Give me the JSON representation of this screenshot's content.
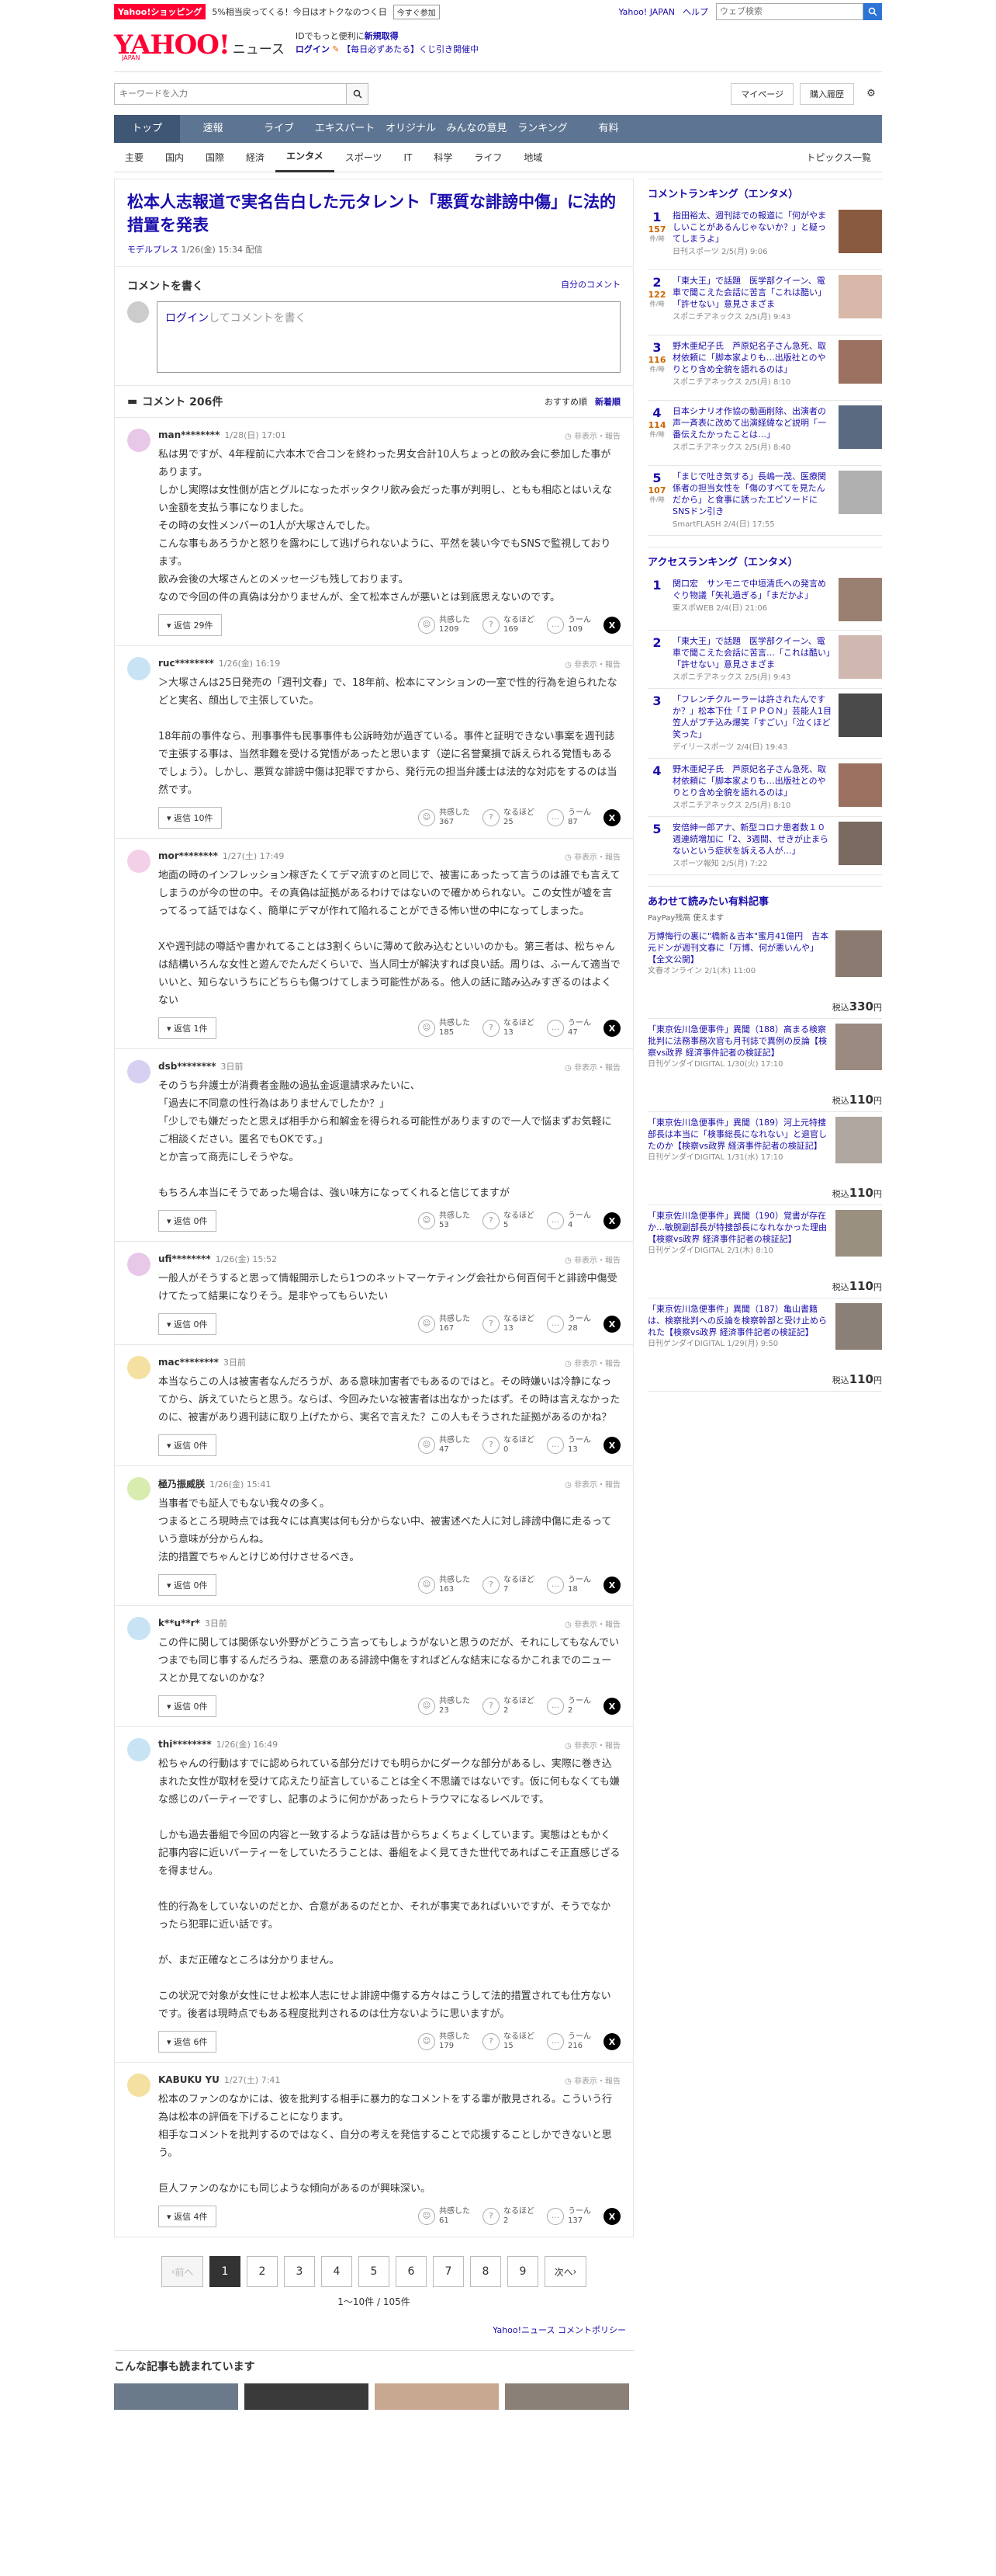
{
  "topbar": {
    "shop_badge": "Yahoo!ショッピング",
    "promo": "5%相当戻ってくる！今日はオトクなのつく日",
    "promo_btn": "今すぐ参加",
    "links": [
      "Yahoo! JAPAN",
      "ヘルプ"
    ],
    "search_placeholder": "ウェブ検索"
  },
  "header": {
    "logo": "YAHOO!",
    "logo_sub": "JAPAN",
    "service": "ニュース",
    "id_line1": "IDでもっと便利に",
    "id_line1_bold": "新規取得",
    "login": "ログイン",
    "lottery": "【毎日必ずあたる】くじ引き開催中"
  },
  "search": {
    "placeholder": "キーワードを入力",
    "mypage": "マイページ",
    "purchase": "購入履歴"
  },
  "nav": [
    "トップ",
    "速報",
    "ライブ",
    "エキスパート",
    "オリジナル",
    "みんなの意見",
    "ランキング",
    "有料"
  ],
  "subnav": [
    "主要",
    "国内",
    "国際",
    "経済",
    "エンタメ",
    "スポーツ",
    "IT",
    "科学",
    "ライフ",
    "地域"
  ],
  "subnav_active": 4,
  "subnav_right": "トピックス一覧",
  "article": {
    "headline": "松本人志報道で実名告白した元タレント「悪質な誹謗中傷」に法的措置を発表",
    "publisher": "モデルプレス",
    "date": "1/26(金) 15:34 配信"
  },
  "comment_write": {
    "title": "コメントを書く",
    "own": "自分のコメント",
    "login": "ログイン",
    "prompt": "してコメントを書く"
  },
  "comments_header": {
    "count": "コメント 206件",
    "sort_recommended": "おすすめ順",
    "sort_new": "新着順"
  },
  "comments": [
    {
      "user": "man********",
      "date": "1/28(日) 17:01",
      "text": "私は男ですが、4年程前に六本木で合コンを終わった男女合計10人ちょっとの飲み会に参加した事があります。\nしかし実際は女性側が店とグルになったボッタクリ飲み会だった事が判明し、ともも相応とはいえない金額を支払う事になりました。\nその時の女性メンバーの1人が大塚さんでした。\nこんな事もあろうかと怒りを露わにして逃げられないように、平然を装い今でもSNSで監視しております。\n飲み会後の大塚さんとのメッセージも残しております。\nなので今回の件の真偽は分かりませんが、全て松本さんが悪いとは到底思えないのです。",
      "replies": "返信 29件",
      "empathy": "1209",
      "naruhodo": "169",
      "uun": "109",
      "avatar": "#e8c8e8"
    },
    {
      "user": "ruc********",
      "date": "1/26(金) 16:19",
      "text": "＞大塚さんは25日発売の「週刊文春」で、18年前、松本にマンションの一室で性的行為を迫られたなどと実名、顔出しで主張していた。\n\n18年前の事件なら、刑事事件も民事事件も公訴時効が過ぎている。事件と証明できない事案を週刊誌で主張する事は、当然非難を受ける覚悟があったと思います（逆に名誉棄損で訴えられる覚悟もあるでしょう）。しかし、悪質な誹謗中傷は犯罪ですから、発行元の担当弁護士は法的な対応をするのは当然です。",
      "replies": "返信 10件",
      "empathy": "367",
      "naruhodo": "25",
      "uun": "87",
      "avatar": "#c8e4f4"
    },
    {
      "user": "mor********",
      "date": "1/27(土) 17:49",
      "text": "地面の時のインフレッション稼ぎたくてデマ流すのと同じで、被害にあったって言うのは誰でも言えてしまうのが今の世の中。その真偽は証拠があるわけではないので確かめられない。この女性が嘘を言ってるって話ではなく、簡単にデマが作れて陥れることができる怖い世の中になってしまった。\n\nXや週刊誌の噂話や書かれてることは3割くらいに薄めて飲み込むといいのかも。第三者は、松ちゃんは結構いろんな女性と遊んでたんだくらいで、当人同士が解決すれば良い話。周りは、ふーんて適当でいいと、知らないうちにどちらも傷つけてしまう可能性がある。他人の話に踏み込みすぎるのはよくない",
      "replies": "返信 1件",
      "empathy": "185",
      "naruhodo": "13",
      "uun": "47",
      "avatar": "#f4d0e8"
    },
    {
      "user": "dsb********",
      "date": "3日前",
      "text": "そのうち弁護士が消費者金融の過払金返還請求みたいに、\n「過去に不同意の性行為はありませんでしたか？」\n「少しでも嫌だったと思えば相手から和解金を得られる可能性がありますので一人で悩まずお気軽にご相談ください。匿名でもOKです。」\nとか言って商売にしそうやな。\n\nもちろん本当にそうであった場合は、強い味方になってくれると信じてますが",
      "replies": "返信 0件",
      "empathy": "53",
      "naruhodo": "5",
      "uun": "4",
      "avatar": "#d8d0f0"
    },
    {
      "user": "ufi********",
      "date": "1/26(金) 15:52",
      "text": "一般人がそうすると思って情報開示したら1つのネットマーケティング会社から何百何千と誹謗中傷受けてたって結果になりそう。是非やってもらいたい",
      "replies": "返信 0件",
      "empathy": "167",
      "naruhodo": "13",
      "uun": "28",
      "avatar": "#e8c8e8"
    },
    {
      "user": "mac********",
      "date": "3日前",
      "text": "本当ならこの人は被害者なんだろうが、ある意味加害者でもあるのではと。その時嫌いは冷静になってから、訴えていたらと思う。ならば、今回みたいな被害者は出なかったはず。その時は言えなかったのに、被害があり週刊誌に取り上げたから、実名で言えた？この人もそうされた証拠があるのかね？",
      "replies": "返信 0件",
      "empathy": "47",
      "naruhodo": "0",
      "uun": "13",
      "avatar": "#f4e0a0"
    },
    {
      "user": "極乃振威朕",
      "date": "1/26(金) 15:41",
      "text": "当事者でも証人でもない我々の多く。\nつまるところ現時点では我々には真実は何も分からない中、被害述べた人に対し誹謗中傷に走るっていう意味が分からんね。\n法的措置でちゃんとけじめ付けさせるべき。",
      "replies": "返信 0件",
      "empathy": "163",
      "naruhodo": "7",
      "uun": "18",
      "avatar": "#d8ecb0"
    },
    {
      "user": "k**u**r*",
      "date": "3日前",
      "text": "この件に関しては関係ない外野がどうこう言ってもしょうがないと思うのだが、それにしてもなんでいつまでも同じ事するんだろうね、悪意のある誹謗中傷をすればどんな結末になるかこれまでのニュースとか見てないのかな？",
      "replies": "返信 0件",
      "empathy": "23",
      "naruhodo": "2",
      "uun": "2",
      "avatar": "#c8e4f4"
    },
    {
      "user": "thi********",
      "date": "1/26(金) 16:49",
      "text": "松ちゃんの行動はすでに認められている部分だけでも明らかにダークな部分があるし、実際に巻き込まれた女性が取材を受けて応えたり証言していることは全く不思議ではないです。仮に何もなくても嫌な感じのパーティーですし、記事のように何かがあったらトラウマになるレベルです。\n\nしかも過去番組で今回の内容と一致するような話は昔からちょくちょくしています。実態はともかく記事内容に近いパーティーをしていたろうことは、番組をよく見てきた世代であればこそ正直感じざるを得ません。\n\n性的行為をしていないのだとか、合意があるのだとか、それが事実であればいいですが、そうでなかったら犯罪に近い話です。\n\nが、まだ正確なところは分かりません。\n\nこの状況で対象が女性にせよ松本人志にせよ誹謗中傷する方々はこうして法的措置されても仕方ないです。後者は現時点でもある程度批判されるのは仕方ないように思いますが。",
      "replies": "返信 6件",
      "empathy": "179",
      "naruhodo": "15",
      "uun": "216",
      "avatar": "#c8e4f4"
    },
    {
      "user": "KABUKU YU",
      "date": "1/27(土) 7:41",
      "text": "松本のファンのなかには、彼を批判する相手に暴力的なコメントをする輩が散見される。こういう行為は松本の評価を下げることになります。\n相手なコメントを批判するのではなく、自分の考えを発信することで応援することしかできないと思う。\n\n巨人ファンのなかにも同じような傾向があるのが興味深い。",
      "replies": "返信 4件",
      "empathy": "61",
      "naruhodo": "2",
      "uun": "137",
      "avatar": "#f4e0a0"
    }
  ],
  "react_labels": {
    "empathy": "共感した",
    "naruhodo": "なるほど",
    "uun": "うーん"
  },
  "report": "非表示・報告",
  "pager": {
    "prev": "前へ",
    "pages": [
      "1",
      "2",
      "3",
      "4",
      "5",
      "6",
      "7",
      "8",
      "9"
    ],
    "next": "次へ",
    "summary": "1〜10件 / 105件"
  },
  "policy": "Yahoo!ニュース コメントポリシー",
  "recs_title": "こんな記事も読まれています",
  "comment_ranking": {
    "title": "コメントランキング（エンタメ）",
    "unit": "件/時",
    "items": [
      {
        "n": "1",
        "count": "157",
        "text": "指田裕太、週刊誌での報道に「何がやましいことがあるんじゃないか？」と疑ってしまうよ」",
        "src": "日刊スポーツ 2/5(月) 9:06"
      },
      {
        "n": "2",
        "count": "122",
        "text": "「東大王」で話題　医学部クイーン、電車で聞こえた会話に苦言「これは酷い」「許せない」意見さまざま",
        "src": "スポニチアネックス 2/5(月) 9:43"
      },
      {
        "n": "3",
        "count": "116",
        "text": "野木亜紀子氏　芦原妃名子さん急死、取材依頼に「脚本家よりも…出版社とのやりとり含め全貌を語れるのは」",
        "src": "スポニチアネックス 2/5(月) 8:10"
      },
      {
        "n": "4",
        "count": "114",
        "text": "日本シナリオ作協の動画削除、出演者の声一斉表に改めて出演経緯など説明「一番伝えたかったことは…」",
        "src": "スポニチアネックス 2/5(月) 8:40"
      },
      {
        "n": "5",
        "count": "107",
        "text": "「まじで吐き気する」長嶋一茂、医療関係者の担当女性を「傷のすべてを見たんだから」と食事に誘ったエピソードにSNSドン引き",
        "src": "SmartFLASH 2/4(日) 17:55"
      }
    ]
  },
  "access_ranking": {
    "title": "アクセスランキング（エンタメ）",
    "items": [
      {
        "n": "1",
        "text": "関口宏　サンモニで中垣清氏への発言めぐり物議「矢礼過ぎる」「まだかよ」",
        "src": "東スポWEB 2/4(日) 21:06"
      },
      {
        "n": "2",
        "text": "「東大王」で話題　医学部クイーン、電車で聞こえた会話に苦言…「これは酷い」「許せない」意見さまざま",
        "src": "スポニチアネックス 2/5(月) 9:43"
      },
      {
        "n": "3",
        "text": "「フレンチクルーラーは許されたんですか？」松本下仕「ＩＰＰＯＮ」芸能人1目笠人がプチ込み爆笑「すごい」「泣くほど笑った」",
        "src": "デイリースポーツ 2/4(日) 19:43"
      },
      {
        "n": "4",
        "text": "野木亜紀子氏　芦原妃名子さん急死、取材依頼に「脚本家よりも…出版社とのやりとり含め全貌を語れるのは」",
        "src": "スポニチアネックス 2/5(月) 8:10"
      },
      {
        "n": "5",
        "text": "安倍紳一郎アナ、新型コロナ患者数１０週連続増加に「2、3週間、せきが止まらないという症状を訴える人が…」",
        "src": "スポーツ報知 2/5(月) 7:22"
      }
    ]
  },
  "paid": {
    "title": "あわせて読みたい有料記事",
    "paypay": "PayPay残高 使えます",
    "items": [
      {
        "text": "万博悔行の裏に\"橋新＆吉本\"蜜月41億円　吉本元ドンが週刊文春に「万博、何が悪いんや」【全文公開】",
        "src": "文春オンライン 2/1(木) 11:00",
        "price": "330"
      },
      {
        "text": "「東京佐川急便事件」異聞（188）高まる検察批判に法務事務次官も月刊誌で異例の反論【検察vs政界 経済事件記者の検証記】",
        "src": "日刊ゲンダイDIGITAL 1/30(火) 17:10",
        "price": "110"
      },
      {
        "text": "「東京佐川急便事件」異聞（189）河上元特捜部長は本当に「検事総長になれない」と退官したのか【検察vs政界 経済事件記者の検証記】",
        "src": "日刊ゲンダイDIGITAL 1/31(水) 17:10",
        "price": "110"
      },
      {
        "text": "「東京佐川急便事件」異聞（190）覚書が存在か…敏腕副部長が特捜部長になれなかった理由【検察vs政界 経済事件記者の検証記】",
        "src": "日刊ゲンダイDIGITAL 2/1(木) 8:10",
        "price": "110"
      },
      {
        "text": "「東京佐川急便事件」異聞（187）亀山書籍は、検察批判への反論を検察幹部と受け止められた【検察vs政界 経済事件記者の検証記】",
        "src": "日刊ゲンダイDIGITAL 1/29(月) 9:50",
        "price": "110"
      }
    ],
    "price_prefix": "税込",
    "price_suffix": "円"
  }
}
